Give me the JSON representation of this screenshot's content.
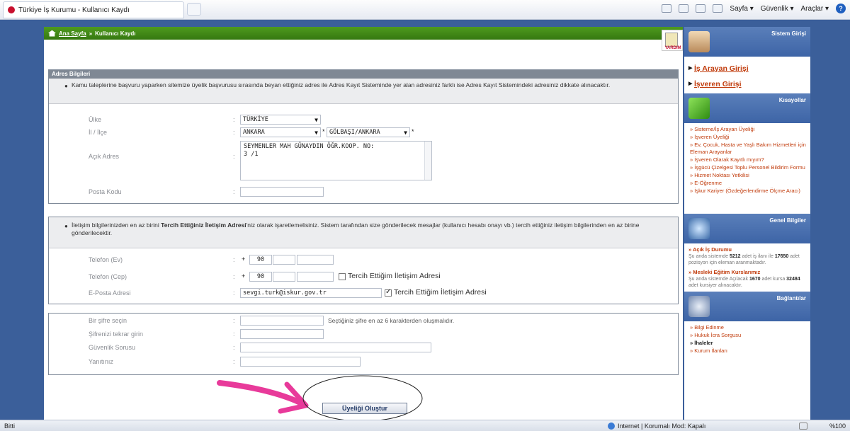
{
  "browser": {
    "tab_title": "Türkiye İş Kurumu - Kullanıcı Kaydı",
    "menu": {
      "page": "Sayfa ▾",
      "security": "Güvenlik ▾",
      "tools": "Araçlar ▾"
    }
  },
  "breadcrumb": {
    "home": "Ana Sayfa",
    "separator": "»",
    "current": "Kullanıcı Kaydı"
  },
  "corner_badge": "YARDIM",
  "address": {
    "title": "Adres Bilgileri",
    "note": "Kamu taleplerine başvuru yaparken sitemize üyelik başvurusu sırasında beyan ettiğiniz adres ile Adres Kayıt Sisteminde yer alan adresiniz farklı ise Adres Kayıt Sistemindeki adresiniz dikkate alınacaktır.",
    "country_label": "Ülke",
    "country_value": "TÜRKİYE",
    "city_label": "İl / İlçe",
    "city_value": "ANKARA",
    "district_value": "GÖLBAŞI/ANKARA",
    "required_mark": "*",
    "address_label": "Açık Adres",
    "address_line1": "SEYMENLER MAH      GÜNAYDIN ÖĞR.KOOP.  NO:",
    "address_line2": "3   /1",
    "postal_label": "Posta Kodu",
    "colon": ":"
  },
  "contact": {
    "note_before": "İletişim bilgilerinizden en az birini ",
    "note_bold": "Tercih Ettiğiniz İletişim Adresi",
    "note_after": "'niz olarak işaretlemelisiniz. Sistem tarafından size gönderilecek mesajlar (kullanıcı hesabı onayı vb.) tercih ettiğiniz iletişim bilgilerinden en az birine gönderilecektir.",
    "home_phone_label": "Telefon (Ev)",
    "mobile_phone_label": "Telefon (Cep)",
    "email_label": "E-Posta Adresi",
    "plus": "+",
    "country_code": "90",
    "email_value": "sevgi.turk@iskur.gov.tr",
    "preferred_label": "Tercih Ettiğim İletişim Adresi",
    "mobile_preferred": false,
    "email_preferred": true
  },
  "password": {
    "password_label": "Bir şifre seçin",
    "password_hint": "Seçtiğiniz şifre en az 6 karakterden oluşmalıdır.",
    "repeat_label": "Şifrenizi tekrar girin",
    "question_label": "Güvenlik Sorusu",
    "answer_label": "Yanıtınız"
  },
  "submit_label": "Üyeliği Oluştur",
  "sidebar": {
    "login_title": "Sistem Girişi",
    "jobseeker_login": "İş Arayan Girişi",
    "employer_login": "İşveren Girişi",
    "shortcuts_title": "Kısayollar",
    "shortcuts": [
      "» Sisteme/İş Arayan Üyeliği",
      "» İşveren Üyeliği",
      "» Ev, Çocuk, Hasta ve Yaşlı Bakım Hizmetleri için Eleman Arayanlar",
      "» İşveren Olarak Kayıtlı mıyım?",
      "» İşgücü Çizelgesi Toplu Personel Bildirim Formu",
      "» Hizmet Noktası Yetkilisi",
      "» E-Öğrenme",
      "» İşkur Kariyer (Özdeğerlendirme Ölçme Aracı)"
    ],
    "general_title": "Genel Bilgiler",
    "open_jobs_title": "» Açık İş Durumu",
    "open_jobs_pre": "Şu anda sistemde ",
    "open_jobs_count": "5212",
    "open_jobs_mid": " adet iş ilanı ile ",
    "open_jobs_positions": "17650",
    "open_jobs_post": " adet pozisyon için eleman aranmaktadır.",
    "courses_title": "» Mesleki Eğitim Kurslarımız",
    "courses_pre": "Şu anda sistemde Açılacak ",
    "courses_count": "1670",
    "courses_mid": " adet kursa ",
    "courses_seats": "32484",
    "courses_post": " adet kursiyer alınacaktır.",
    "links_title": "Bağlantılar",
    "links": [
      "» Bilgi Edinme",
      "» Hukuk İcra Sorgusu",
      "» İhaleler",
      "» Kurum İlanları"
    ]
  },
  "statusbar": {
    "left": "Bitti",
    "zone": "Internet | Korumalı Mod: Kapalı",
    "zoom": "%100"
  },
  "colors": {
    "green_bar": "#3f8716",
    "section_head": "#7f8894",
    "sidebar_head": "#4a70b0",
    "link": "#c03a0a",
    "annotation_arrow": "#e83a9a"
  }
}
